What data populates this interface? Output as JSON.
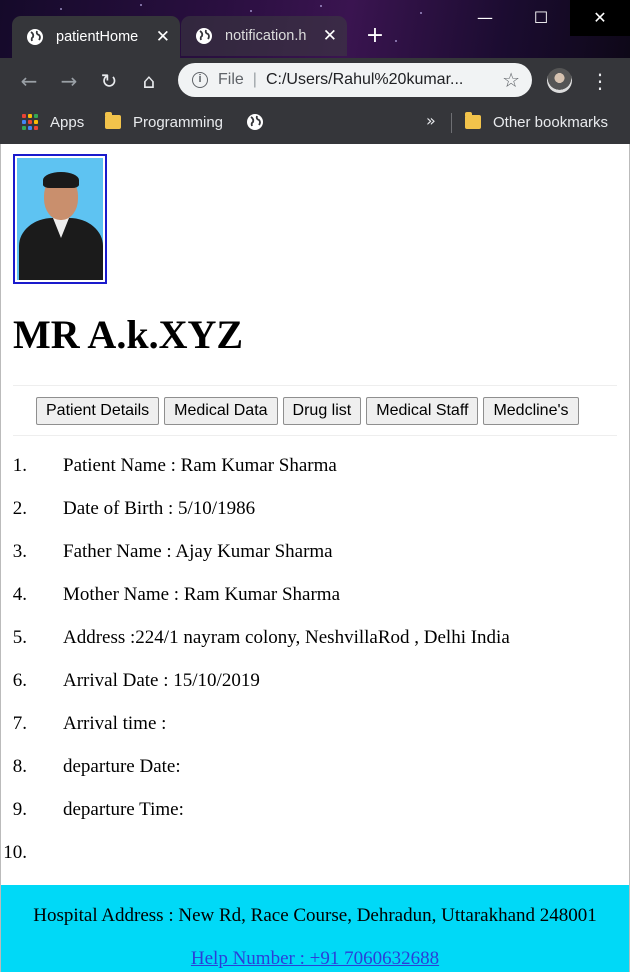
{
  "browser": {
    "tabs": [
      {
        "title": "patientHome"
      },
      {
        "title": "notification.h"
      }
    ],
    "address": {
      "scheme_label": "File",
      "url": "C:/Users/Rahul%20kumar..."
    },
    "bookmarks": {
      "apps": "Apps",
      "programming": "Programming",
      "overflow": "»",
      "other": "Other bookmarks"
    },
    "icons": {
      "minimize": "—",
      "maximize": "☐",
      "close": "✕",
      "back": "←",
      "forward": "→",
      "reload": "↻",
      "home": "⌂",
      "star": "☆",
      "menu": "⋮",
      "new_tab": "+",
      "tab_close": "✕"
    }
  },
  "profile": {
    "name": "MR A.k.XYZ"
  },
  "nav_buttons": [
    "Patient Details",
    "Medical Data",
    "Drug list",
    "Medical Staff",
    "Medcline's"
  ],
  "details": [
    {
      "num": "1.",
      "text": "Patient Name : Ram Kumar Sharma"
    },
    {
      "num": "2.",
      "text": "Date of Birth : 5/10/1986"
    },
    {
      "num": "3.",
      "text": "Father Name : Ajay Kumar Sharma"
    },
    {
      "num": "4.",
      "text": "Mother Name : Ram Kumar Sharma"
    },
    {
      "num": "5.",
      "text": "Address :224/1 nayram colony, NeshvillaRod , Delhi India"
    },
    {
      "num": "6.",
      "text": "Arrival Date : 15/10/2019"
    },
    {
      "num": "7.",
      "text": "Arrival time :"
    },
    {
      "num": "8.",
      "text": "departure Date:"
    },
    {
      "num": "9.",
      "text": "departure Time:"
    },
    {
      "num": "10.",
      "text": ""
    }
  ],
  "footer": {
    "address": "Hospital Address : New Rd, Race Course, Dehradun, Uttarakhand 248001",
    "help": "Help Number : +91 7060632688"
  },
  "colors": {
    "footer_bg": "#00d9f7",
    "link": "#2a3fd8",
    "photo_border": "#1a1acc"
  }
}
